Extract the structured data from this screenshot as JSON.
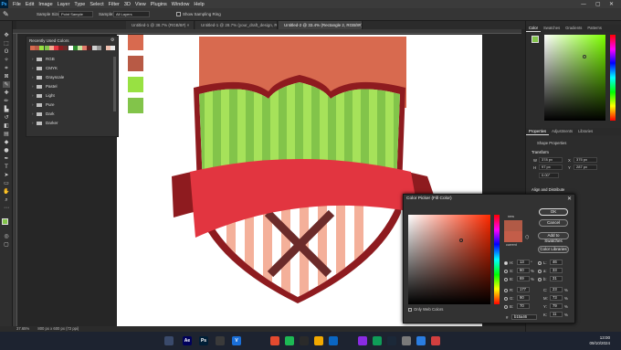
{
  "menubar": {
    "logo": "Ps",
    "items": [
      "File",
      "Edit",
      "Image",
      "Layer",
      "Type",
      "Select",
      "Filter",
      "3D",
      "View",
      "Plugins",
      "Window",
      "Help"
    ],
    "window_controls": [
      "—",
      "▢",
      "✕"
    ]
  },
  "options": {
    "sample_size_label": "Sample Size:",
    "sample_size_value": "Point Sample",
    "sample_label": "Sample:",
    "sample_value": "All Layers",
    "show_ring_label": "Show Sampling Ring"
  },
  "tabs": [
    "Untitled-1 @ 38.7% (RGB/8#) ×",
    "Untitled-1 @ 28.7% (your_draft_design, RGB/8#) ×",
    "Untitled-2 @ 33.4% (Rectangle 2, RGB/8#) ×"
  ],
  "recent_panel": {
    "title": "Recently Used Colors",
    "swatches": [
      "#d86a4f",
      "#b85a45",
      "#98e142",
      "#82c44a",
      "#f4a88f",
      "#e23540",
      "#8e1b1f",
      "#6b2b2a",
      "#ffffff",
      "#2f8c2f",
      "#c8e8a0",
      "#e07a6a",
      "#5a2020",
      "#d0d0d0",
      "#999999",
      "#333333",
      "#f0c0b0",
      "#e8e8e8"
    ],
    "folders": [
      "RGB",
      "CMYK",
      "Grayscale",
      "Pastel",
      "Light",
      "Pure",
      "Dark",
      "Darker"
    ]
  },
  "canvas_tiles": [
    "#d86a4f",
    "#b85a45",
    "#98e142",
    "#82c44a"
  ],
  "right_panel": {
    "color_tabs": [
      "Color",
      "Swatches",
      "Gradients",
      "Patterns"
    ],
    "props_tabs": [
      "Properties",
      "Adjustments",
      "Libraries"
    ],
    "props_kind": "Shape Properties",
    "transform_label": "Transform",
    "w_label": "W",
    "w_value": "378 px",
    "h_label": "H",
    "h_value": "97 px",
    "x_label": "X",
    "x_value": "375 px",
    "y_label": "Y",
    "y_value": "287 px",
    "angle_value": "0.00°",
    "align_label": "Align and Distribute",
    "foreground": "#82c44a",
    "field_hue": "#7dff00",
    "field_ring_hex": "#82c44a"
  },
  "picker": {
    "title": "Color Picker (Fill Color)",
    "ok": "OK",
    "cancel": "Cancel",
    "add_swatches": "Add to Swatches",
    "color_libraries": "Color Libraries",
    "new_label": "new",
    "current_label": "current",
    "new_color": "#b15a46",
    "current_color": "#c35d49",
    "only_web": "Only Web Colors",
    "fields": {
      "H": "13",
      "S": "60",
      "B": "69",
      "R": "177",
      "G": "90",
      "Bl": "70",
      "L": "46",
      "a": "33",
      "b": "31",
      "C": "23",
      "M": "73",
      "Y": "79",
      "K": "11"
    },
    "units": {
      "H": "°",
      "S": "%",
      "B": "%",
      "C": "%",
      "M": "%",
      "Y": "%",
      "K": "%"
    },
    "hex_label": "#",
    "hex": "b15a46"
  },
  "status": {
    "zoom": "37.65%",
    "doc": "800 px x 600 px (72 ppi)"
  },
  "taskbar": {
    "time": "13:00",
    "date": "09/10/2024",
    "apps": [
      {
        "label": "",
        "color": "#3a4a6b"
      },
      {
        "label": "Ae",
        "color": "#00005b"
      },
      {
        "label": "Ps",
        "color": "#001e36"
      },
      {
        "label": "",
        "color": "#3a3a3a"
      },
      {
        "label": "V",
        "color": "#1a6fd8"
      },
      {
        "label": "",
        "color": "#e34a2f"
      },
      {
        "label": "",
        "color": "#1db954"
      },
      {
        "label": "",
        "color": "#2a2a2a"
      },
      {
        "label": "",
        "color": "#f2a900"
      },
      {
        "label": "",
        "color": "#0a66c2"
      },
      {
        "label": "",
        "color": "#8a2be2"
      },
      {
        "label": "",
        "color": "#0f9d58"
      },
      {
        "label": "",
        "color": "#1b2838"
      },
      {
        "label": "",
        "color": "#7a7a7a"
      },
      {
        "label": "",
        "color": "#2a7de1"
      },
      {
        "label": "",
        "color": "#d23f3f"
      }
    ]
  }
}
